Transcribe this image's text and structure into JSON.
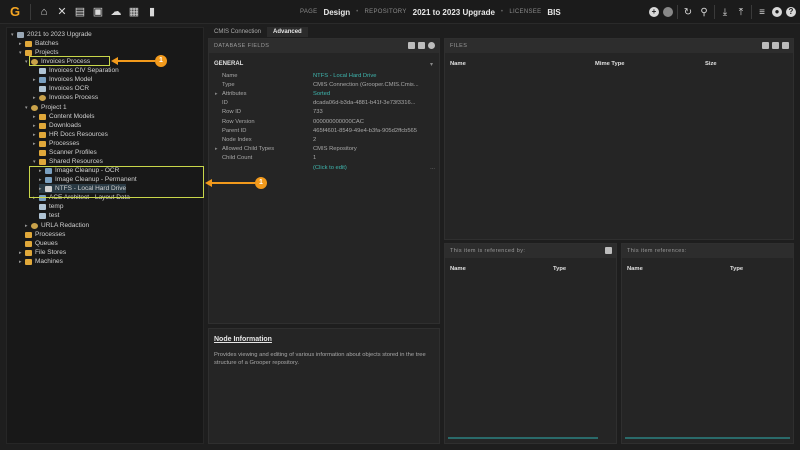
{
  "topbar": {
    "logo": "G",
    "page_label": "PAGE",
    "page_value": "Design",
    "repo_label": "REPOSITORY",
    "repo_value": "2021 to 2023 Upgrade",
    "licensee_label": "LICENSEE",
    "licensee_value": "BIS",
    "left_icons": [
      "home-icon",
      "tools-icon",
      "archive-icon",
      "inbox-icon",
      "cloud-icon",
      "briefcase-icon",
      "chart-icon"
    ],
    "right_icons": [
      "add-circle-icon",
      "circle-dim-icon",
      "refresh-icon",
      "search-icon",
      "download-icon",
      "upload-icon",
      "database-icon",
      "user-icon",
      "help-icon"
    ]
  },
  "tree": {
    "nodes": [
      {
        "label": "2021 to 2023 Upgrade",
        "icon": "repo",
        "arrow": "▾"
      },
      {
        "label": "Batches",
        "icon": "folder",
        "arrow": "▸"
      },
      {
        "label": "Projects",
        "icon": "folder",
        "arrow": "▾"
      },
      {
        "label": "Invoices Process",
        "icon": "gear",
        "arrow": "▾"
      },
      {
        "label": "Invoices CIV Separation",
        "icon": "doc2",
        "arrow": ""
      },
      {
        "label": "Invoices Model",
        "icon": "doc",
        "arrow": "▸"
      },
      {
        "label": "Invoices OCR",
        "icon": "doc2",
        "arrow": ""
      },
      {
        "label": "Invoices Process",
        "icon": "gear",
        "arrow": "▸"
      },
      {
        "label": "Project 1",
        "icon": "gear",
        "arrow": "▾"
      },
      {
        "label": "Content Models",
        "icon": "folder",
        "arrow": "▸"
      },
      {
        "label": "Downloads",
        "icon": "folder",
        "arrow": "▸"
      },
      {
        "label": "HR Docs Resources",
        "icon": "folder",
        "arrow": "▸"
      },
      {
        "label": "Processes",
        "icon": "folder",
        "arrow": "▸"
      },
      {
        "label": "Scanner Profiles",
        "icon": "folder",
        "arrow": ""
      },
      {
        "label": "Shared Resources",
        "icon": "folder",
        "arrow": "▾"
      },
      {
        "label": "Image Cleanup - OCR",
        "icon": "doc",
        "arrow": "▸"
      },
      {
        "label": "Image Cleanup - Permanent",
        "icon": "doc",
        "arrow": "▸"
      },
      {
        "label": "NTFS - Local Hard Drive",
        "icon": "hdd",
        "arrow": "▸"
      },
      {
        "label": "ACE Architect - Layout Data",
        "icon": "doc",
        "arrow": "▸"
      },
      {
        "label": "temp",
        "icon": "doc2",
        "arrow": ""
      },
      {
        "label": "test",
        "icon": "doc2",
        "arrow": ""
      },
      {
        "label": "URLA Redaction",
        "icon": "gear",
        "arrow": "▸"
      },
      {
        "label": "Processes",
        "icon": "folder",
        "arrow": ""
      },
      {
        "label": "Queues",
        "icon": "folder",
        "arrow": ""
      },
      {
        "label": "File Stores",
        "icon": "folder",
        "arrow": "▸"
      },
      {
        "label": "Machines",
        "icon": "folder",
        "arrow": "▸"
      }
    ]
  },
  "tabs": [
    "CMIS Connection",
    "Advanced"
  ],
  "db_panel": {
    "title": "DATABASE FIELDS",
    "section": "GENERAL",
    "rows": [
      {
        "key": "Name",
        "value": "NTFS - Local Hard Drive",
        "link": true,
        "expand": ""
      },
      {
        "key": "Type",
        "value": "CMIS Connection (Grooper.CMIS.Cmis...",
        "link": false,
        "expand": ""
      },
      {
        "key": "Attributes",
        "value": "Sorted",
        "link": true,
        "expand": "▸"
      },
      {
        "key": "ID",
        "value": "dcada06d-b3da-4881-b41f-3e73f3316...",
        "link": false,
        "expand": ""
      },
      {
        "key": "Row ID",
        "value": "733",
        "link": false,
        "expand": ""
      },
      {
        "key": "Row Version",
        "value": "000000000000CAC",
        "link": false,
        "expand": ""
      },
      {
        "key": "Parent ID",
        "value": "465f4601-8549-49e4-b3fa-905d2ffcb565",
        "link": false,
        "expand": ""
      },
      {
        "key": "Node Index",
        "value": "2",
        "link": false,
        "expand": ""
      },
      {
        "key": "Allowed Child Types",
        "value": "CMIS Repository",
        "link": false,
        "expand": "▸"
      },
      {
        "key": "Child Count",
        "value": "1",
        "link": false,
        "expand": ""
      },
      {
        "key": "",
        "value": "(Click to edit)",
        "link": true,
        "expand": "",
        "more": "..."
      }
    ]
  },
  "node_info": {
    "title": "Node Information",
    "description": "Provides viewing and editing of various information about objects stored in the tree structure of a Grooper repository."
  },
  "files_panel": {
    "title": "FILES",
    "columns": [
      "Name",
      "Mime Type",
      "Size"
    ]
  },
  "referenced_by": {
    "title": "This item is referenced by:",
    "columns": [
      "Name",
      "Type"
    ]
  },
  "references": {
    "title": "This item references:",
    "columns": [
      "Name",
      "Type"
    ]
  },
  "callouts": [
    "1",
    "1"
  ],
  "colors": {
    "accent": "#f29a1c",
    "highlight": "#c8d64a",
    "link": "#3fb8b0"
  }
}
